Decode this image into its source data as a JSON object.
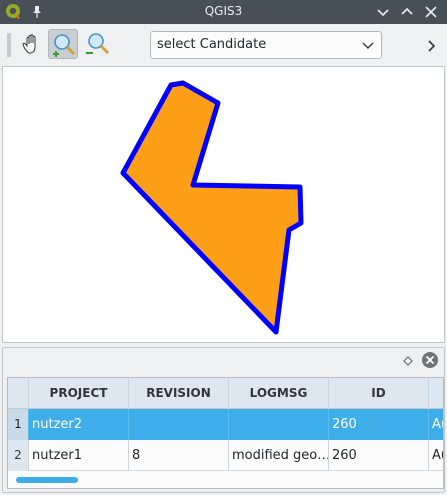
{
  "window": {
    "title": "QGIS3"
  },
  "toolbar": {
    "candidate_select": {
      "value": "select Candidate"
    }
  },
  "map": {
    "polygon_fill": "#ff9e17",
    "polygon_stroke": "#0000ff"
  },
  "table": {
    "columns": [
      "PROJECT",
      "REVISION",
      "LOGMSG",
      "ID",
      ""
    ],
    "rows": [
      {
        "num": "1",
        "project": "nutzer2",
        "revision": "",
        "logmsg": "",
        "id": "260",
        "extra": "Au"
      },
      {
        "num": "2",
        "project": "nutzer1",
        "revision": "8",
        "logmsg": "modified geo…",
        "id": "260",
        "extra": "Au"
      }
    ],
    "selected_row": 1
  },
  "colors": {
    "titlebar": "#475057",
    "selection": "#3daee9",
    "header": "#dde7ef"
  },
  "icons": [
    "qgis-logo-icon",
    "pin-icon",
    "minimize-icon",
    "maximize-icon",
    "close-icon",
    "pan-hand-icon",
    "zoom-in-icon",
    "zoom-out-icon",
    "chevron-down-icon",
    "chevron-right-icon",
    "float-icon",
    "close-circle-icon"
  ]
}
